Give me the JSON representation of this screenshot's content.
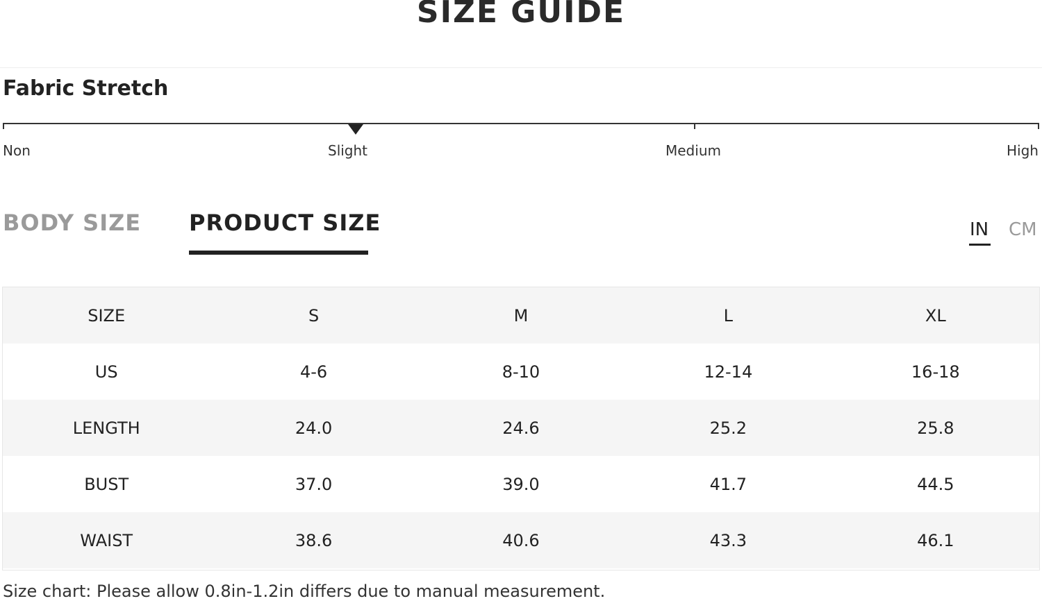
{
  "header": {
    "title": "SIZE GUIDE"
  },
  "fabric_stretch": {
    "title": "Fabric Stretch",
    "levels": [
      "Non",
      "Slight",
      "Medium",
      "High"
    ],
    "selected": "Slight"
  },
  "tabs": [
    {
      "label": "BODY SIZE",
      "active": false
    },
    {
      "label": "PRODUCT SIZE",
      "active": true
    }
  ],
  "units": [
    {
      "label": "IN",
      "active": true
    },
    {
      "label": "CM",
      "active": false
    }
  ],
  "table": {
    "headers": [
      "SIZE",
      "S",
      "M",
      "L",
      "XL"
    ],
    "rows": [
      [
        "US",
        "4-6",
        "8-10",
        "12-14",
        "16-18"
      ],
      [
        "LENGTH",
        "24.0",
        "24.6",
        "25.2",
        "25.8"
      ],
      [
        "BUST",
        "37.0",
        "39.0",
        "41.7",
        "44.5"
      ],
      [
        "WAIST",
        "38.6",
        "40.6",
        "43.3",
        "46.1"
      ]
    ]
  },
  "note": "Size chart: Please allow 0.8in-1.2in differs due to manual measurement."
}
